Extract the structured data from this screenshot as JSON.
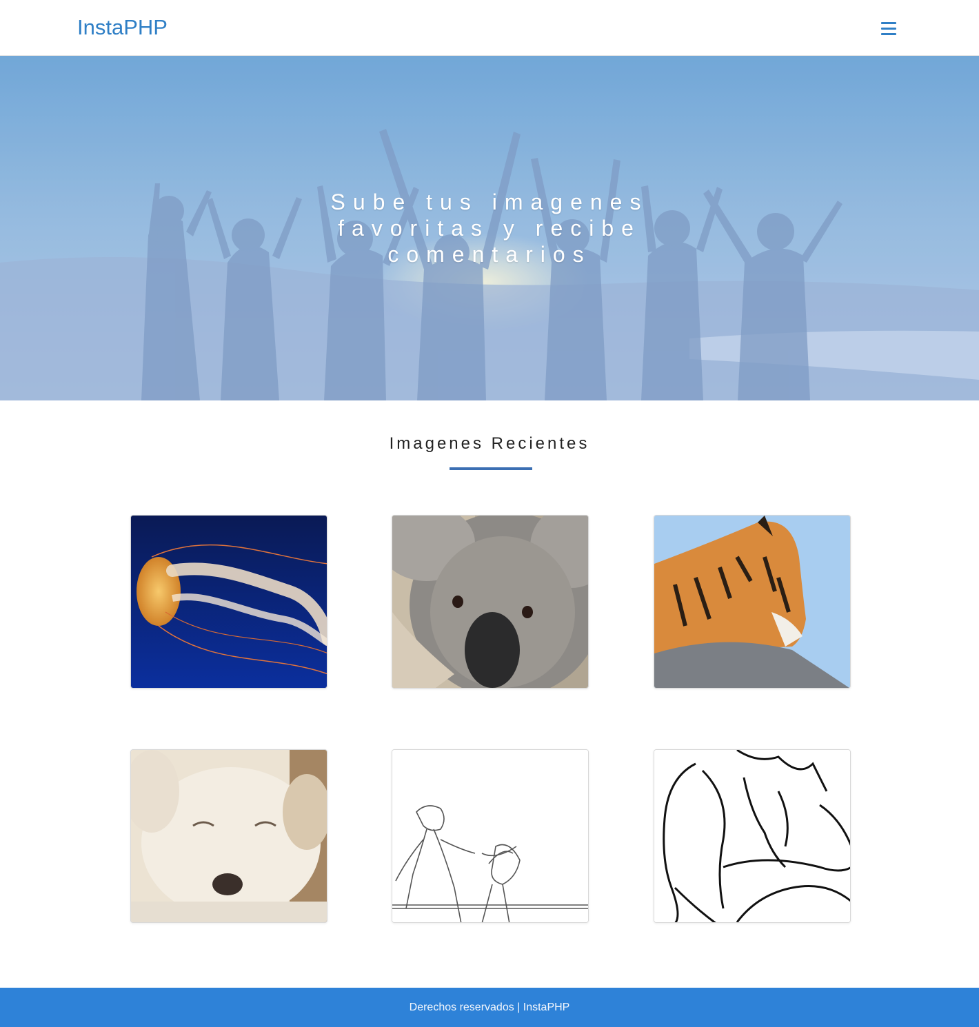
{
  "navbar": {
    "brand": "InstaPHP",
    "menu_icon": "hamburger-menu-icon",
    "brand_color": "#2f7fc6"
  },
  "hero": {
    "title": "Sube tus imagenes favoritas y recibe comentarios"
  },
  "recent": {
    "title": "Imagenes Recientes",
    "accent_color": "#3b6fb3",
    "images": [
      {
        "subject": "jellyfish"
      },
      {
        "subject": "koala"
      },
      {
        "subject": "tiger"
      },
      {
        "subject": "puppy"
      },
      {
        "subject": "sketch-fight"
      },
      {
        "subject": "sketch-muscles"
      }
    ]
  },
  "footer": {
    "text": "Derechos reservados | InstaPHP",
    "color": "#2e82d8"
  }
}
